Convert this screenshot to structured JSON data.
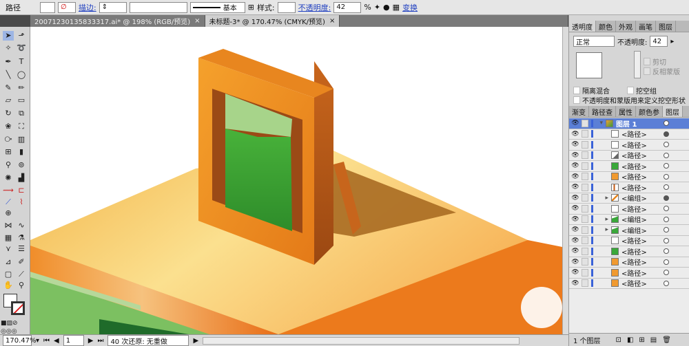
{
  "control_bar": {
    "object_type": "路径",
    "stroke_label": "描边:",
    "stroke_profile": "基本",
    "style_label": "样式:",
    "opacity_label": "不透明度:",
    "opacity_value": "42",
    "percent": "%",
    "transform_label": "变换"
  },
  "doc_tabs": [
    {
      "label": "20071230135833317.ai* @ 198% (RGB/预览)",
      "close": "×"
    },
    {
      "label": "未标题-3* @ 170.47% (CMYK/预览)",
      "close": "×"
    }
  ],
  "status": {
    "zoom": "170.47%",
    "page": "1",
    "message": "40 次还原: 无重做"
  },
  "panel": {
    "tabs": [
      "透明度",
      "颜色",
      "外观",
      "画笔",
      "图层"
    ],
    "blend_mode": "正常",
    "opacity_label": "不透明度:",
    "opacity_value": "42",
    "clip": "剪切",
    "invert_mask": "反相蒙版",
    "isolate_blend": "隔离混合",
    "knockout_group": "挖空组",
    "opacity_mask_shape": "不透明度和蒙版用来定义挖空形状",
    "layer_tabs": [
      "渐变",
      "路径查",
      "属性",
      "颜色参",
      "图层"
    ],
    "layers": [
      {
        "name": "图层 1",
        "kind": "layer",
        "target": "hollow"
      },
      {
        "name": "<路径>",
        "kind": "path",
        "thumb": "white",
        "target": "fill"
      },
      {
        "name": "<路径>",
        "kind": "path",
        "thumb": "white",
        "target": "hollow"
      },
      {
        "name": "<路径>",
        "kind": "path",
        "thumb": "corner",
        "target": "hollow"
      },
      {
        "name": "<路径>",
        "kind": "path",
        "thumb": "green",
        "target": "hollow"
      },
      {
        "name": "<路径>",
        "kind": "path",
        "thumb": "orange",
        "target": "hollow"
      },
      {
        "name": "<路径>",
        "kind": "path",
        "thumb": "orangebar",
        "target": "hollow"
      },
      {
        "name": "<编组>",
        "kind": "group",
        "thumb": "orangeslash",
        "target": "fill"
      },
      {
        "name": "<路径>",
        "kind": "path",
        "thumb": "white",
        "target": "hollow"
      },
      {
        "name": "<编组>",
        "kind": "group",
        "thumb": "greenslash",
        "target": "hollow"
      },
      {
        "name": "<编组>",
        "kind": "group",
        "thumb": "greenslash",
        "target": "hollow"
      },
      {
        "name": "<路径>",
        "kind": "path",
        "thumb": "white",
        "target": "hollow"
      },
      {
        "name": "<路径>",
        "kind": "path",
        "thumb": "green",
        "target": "hollow"
      },
      {
        "name": "<路径>",
        "kind": "path",
        "thumb": "orange",
        "target": "hollow"
      },
      {
        "name": "<路径>",
        "kind": "path",
        "thumb": "orange",
        "target": "hollow"
      },
      {
        "name": "<路径>",
        "kind": "path",
        "thumb": "orange",
        "target": "hollow"
      }
    ],
    "layer_count": "1 个图层"
  }
}
